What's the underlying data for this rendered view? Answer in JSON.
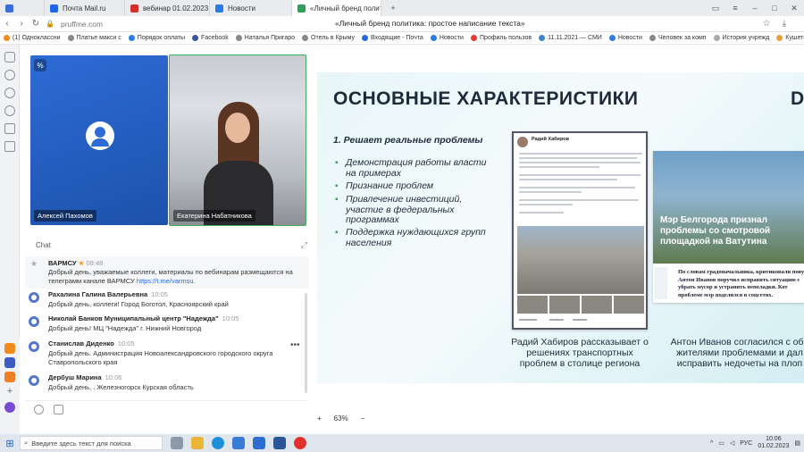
{
  "tabs": [
    {
      "label": "",
      "color": "#3a6fd8"
    },
    {
      "label": "Почта Mail.ru",
      "color": "#1d66e5"
    },
    {
      "label": "вебинар 01.02.2023 (1).p",
      "color": "#d62d2d"
    },
    {
      "label": "Новости",
      "color": "#2a7be4"
    },
    {
      "label": "«Личный бренд политика: простое написание текста»",
      "color": "#2da15a",
      "active": true
    }
  ],
  "address": {
    "url": "pruffme.com",
    "page_title": "«Личный бренд политика: простое написание текста»"
  },
  "bookmarks": [
    "(1) Одноклассни",
    "Платье макси с",
    "Порядок оплаты",
    "Facebook",
    "Наталья Пригаро",
    "Отель в Крыму",
    "Входящие - Почта",
    "Новости",
    "Профиль пользов",
    "11.11.2021 — СМИ",
    "Новости",
    "Человек за комп",
    "История учрежд",
    "Кушетк"
  ],
  "video": {
    "tile1_name": "Алексей Пахомов",
    "tile2_name": "Екатерина Набатникова"
  },
  "chat": {
    "tab": "Chat",
    "pinned": {
      "author": "ВАРМСУ",
      "time": "09:48",
      "text": "Добрый день, уважаемые коллеги, материалы по вебинарам размещаются на телеграмм канале ВАРМСУ",
      "link": "https://t.me/varmsu."
    },
    "messages": [
      {
        "author": "Рахалина Галина Валерьевна",
        "time": "10:05",
        "text": "Добрый день, коллеги! Город Боготол, Красноярский край"
      },
      {
        "author": "Николай Банков Муниципальный центр \"Надежда\"",
        "time": "10:05",
        "text": "Добрый день! МЦ \"Надежда\" г. Нижний Новгород"
      },
      {
        "author": "Станислав Диденко",
        "time": "10:05",
        "text": "Добрый день. Администрация Новоалександровского городского округа Ставропольского края"
      },
      {
        "author": "Дербуш Марина",
        "time": "10:06",
        "text": "Добрый день, . Железногорск Курская область"
      }
    ]
  },
  "slide": {
    "title": "ОСНОВНЫЕ ХАРАКТЕРИСТИКИ",
    "title_right": "D",
    "subtitle": "1. Решает реальные проблемы",
    "bullets": [
      "Демонстрация работы власти на примерах",
      "Признание проблем",
      "Привлечение инвестиций, участие в федеральных программах",
      "Поддержка нуждающихся групп населения"
    ],
    "post1_author": "Радий Хабиров",
    "post2_headline": "Мэр Белгорода признал проблемы со смотровой площадкой на Ватутина",
    "post2_text": "По словам градоначальника, критиковали пову Антон Иванов поручил исправить ситуацию с убрать мусор и устранить неполадки. Кот проблеме мэр поделился в соцсетях.",
    "caption1": "Радий Хабиров рассказывает о решениях транспортных проблем в столице региона",
    "caption2": "Антон Иванов согласился с обо жителями проблемами и дал исправить недочеты на плоп"
  },
  "zoom": {
    "plus": "+",
    "level": "63%",
    "minus": "−"
  },
  "taskbar": {
    "search_placeholder": "Введите здесь текст для поиска",
    "lang": "РУС",
    "time": "10:06",
    "date": "01.02.2023"
  }
}
